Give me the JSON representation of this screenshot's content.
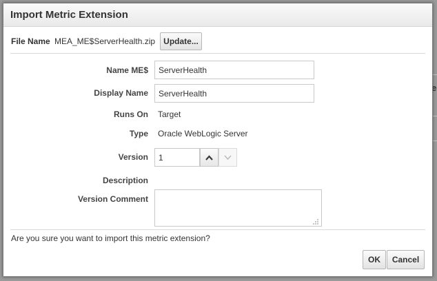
{
  "dialog": {
    "title": "Import Metric Extension",
    "file": {
      "label": "File Name",
      "value": "MEA_ME$ServerHealth.zip",
      "update_label": "Update..."
    },
    "fields": {
      "name": {
        "label": "Name ME$",
        "value": "ServerHealth"
      },
      "display_name": {
        "label": "Display Name",
        "value": "ServerHealth"
      },
      "runs_on": {
        "label": "Runs On",
        "value": "Target"
      },
      "type": {
        "label": "Type",
        "value": "Oracle WebLogic Server"
      },
      "version": {
        "label": "Version",
        "value": "1"
      },
      "description": {
        "label": "Description"
      },
      "version_comment": {
        "label": "Version Comment",
        "value": ""
      }
    },
    "confirm_text": "Are you sure you want to import this metric extension?",
    "ok_label": "OK",
    "cancel_label": "Cancel"
  },
  "background": {
    "partial_text": "e"
  },
  "icons": {
    "spin_up": "chevron-up-icon",
    "spin_down": "chevron-down-icon",
    "resize": "resize-grip-icon"
  }
}
